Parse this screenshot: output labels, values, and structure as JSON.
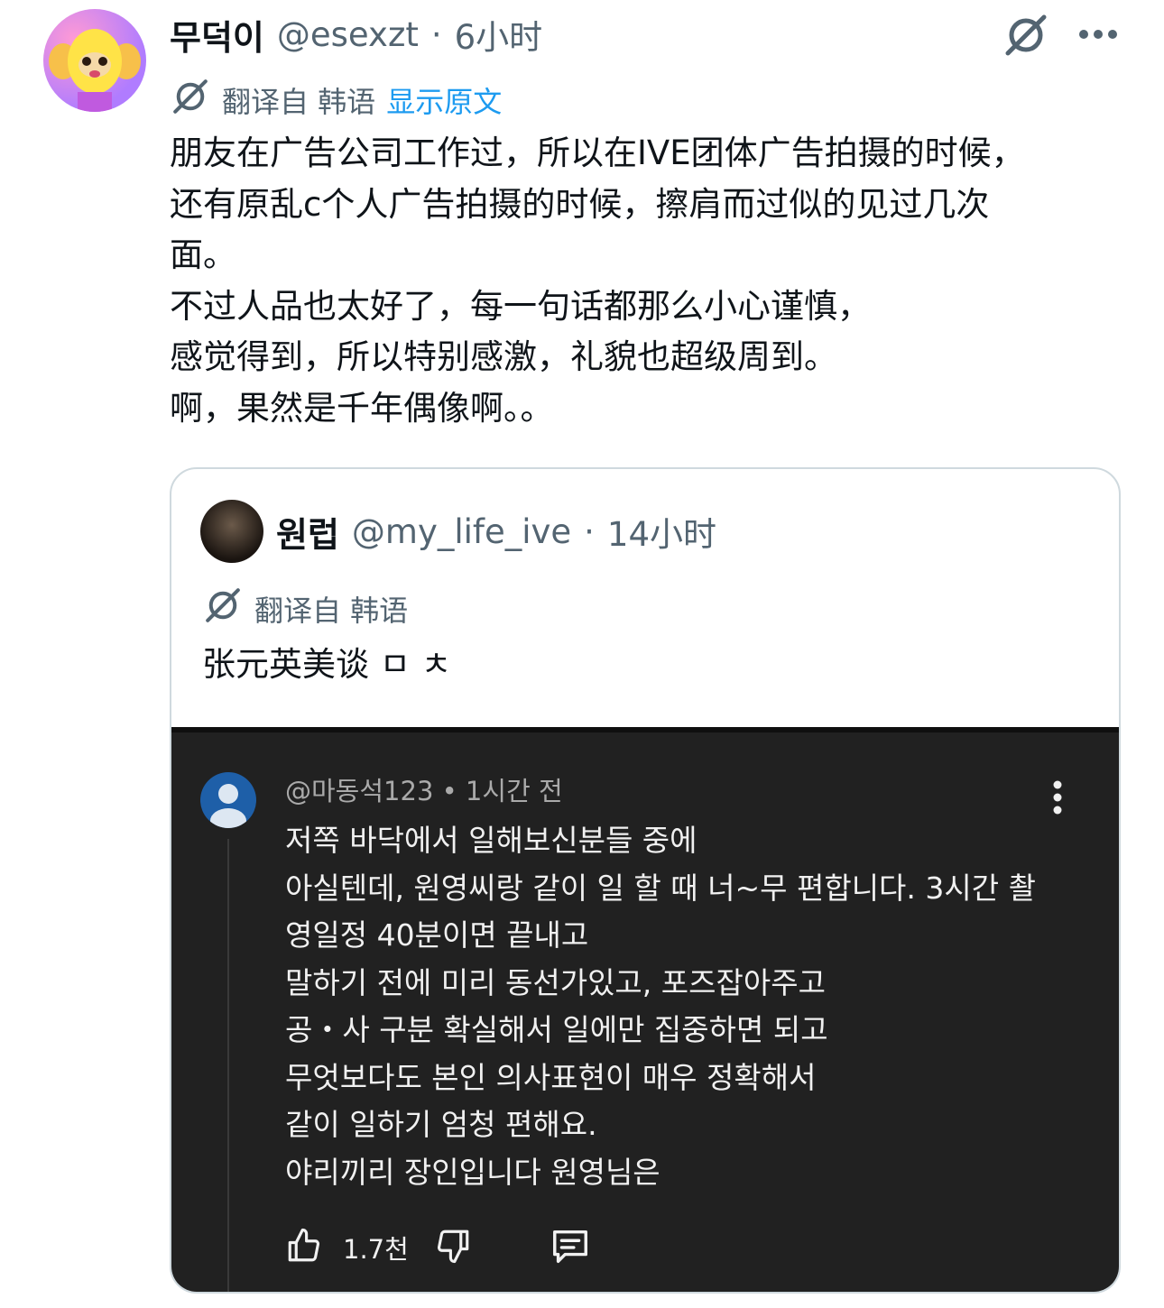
{
  "tweet": {
    "author_name": "무덕이",
    "handle": "@esexzt",
    "separator": "·",
    "time": "6小时",
    "translated_from": "翻译自 韩语",
    "show_original": "显示原文",
    "body": "朋友在广告公司工作过，所以在IVE团体广告拍摄的时候，\n还有原乱c个人广告拍摄的时候，擦肩而过似的见过几次\n面。\n不过人品也太好了，每一句话都那么小心谨慎，\n感觉得到，所以特别感激，礼貌也超级周到。\n啊，果然是千年偶像啊。。"
  },
  "quoted": {
    "author_name": "원럽",
    "handle": "@my_life_ive",
    "separator": "·",
    "time": "14小时",
    "translated_from": "翻译自 韩语",
    "text": "张元英美谈 ㅁ ㅊ"
  },
  "youtube_comment": {
    "meta": "@마동석123 • 1시간 전",
    "text": "저쪽 바닥에서 일해보신분들 중에\n아실텐데, 원영씨랑 같이 일 할 때 너~무 편합니다. 3시간 촬\n영일정 40분이면 끝내고\n말하기 전에 미리 동선가있고, 포즈잡아주고\n공・사 구분 확실해서 일에만 집중하면 되고\n무엇보다도 본인 의사표현이 매우 정확해서\n같이 일하기 엄청 편해요.\n야리끼리 장인입니다 원영님은",
    "like_count": "1.7천"
  },
  "icons": [
    "grok-icon",
    "more-icon",
    "translate-icon",
    "kebab-icon",
    "thumbs-up-icon",
    "thumbs-down-icon",
    "reply-icon"
  ],
  "colors": {
    "link": "#1d9bf0",
    "muted": "#536471",
    "yt_bg": "#212121",
    "border": "#cfd9de"
  }
}
